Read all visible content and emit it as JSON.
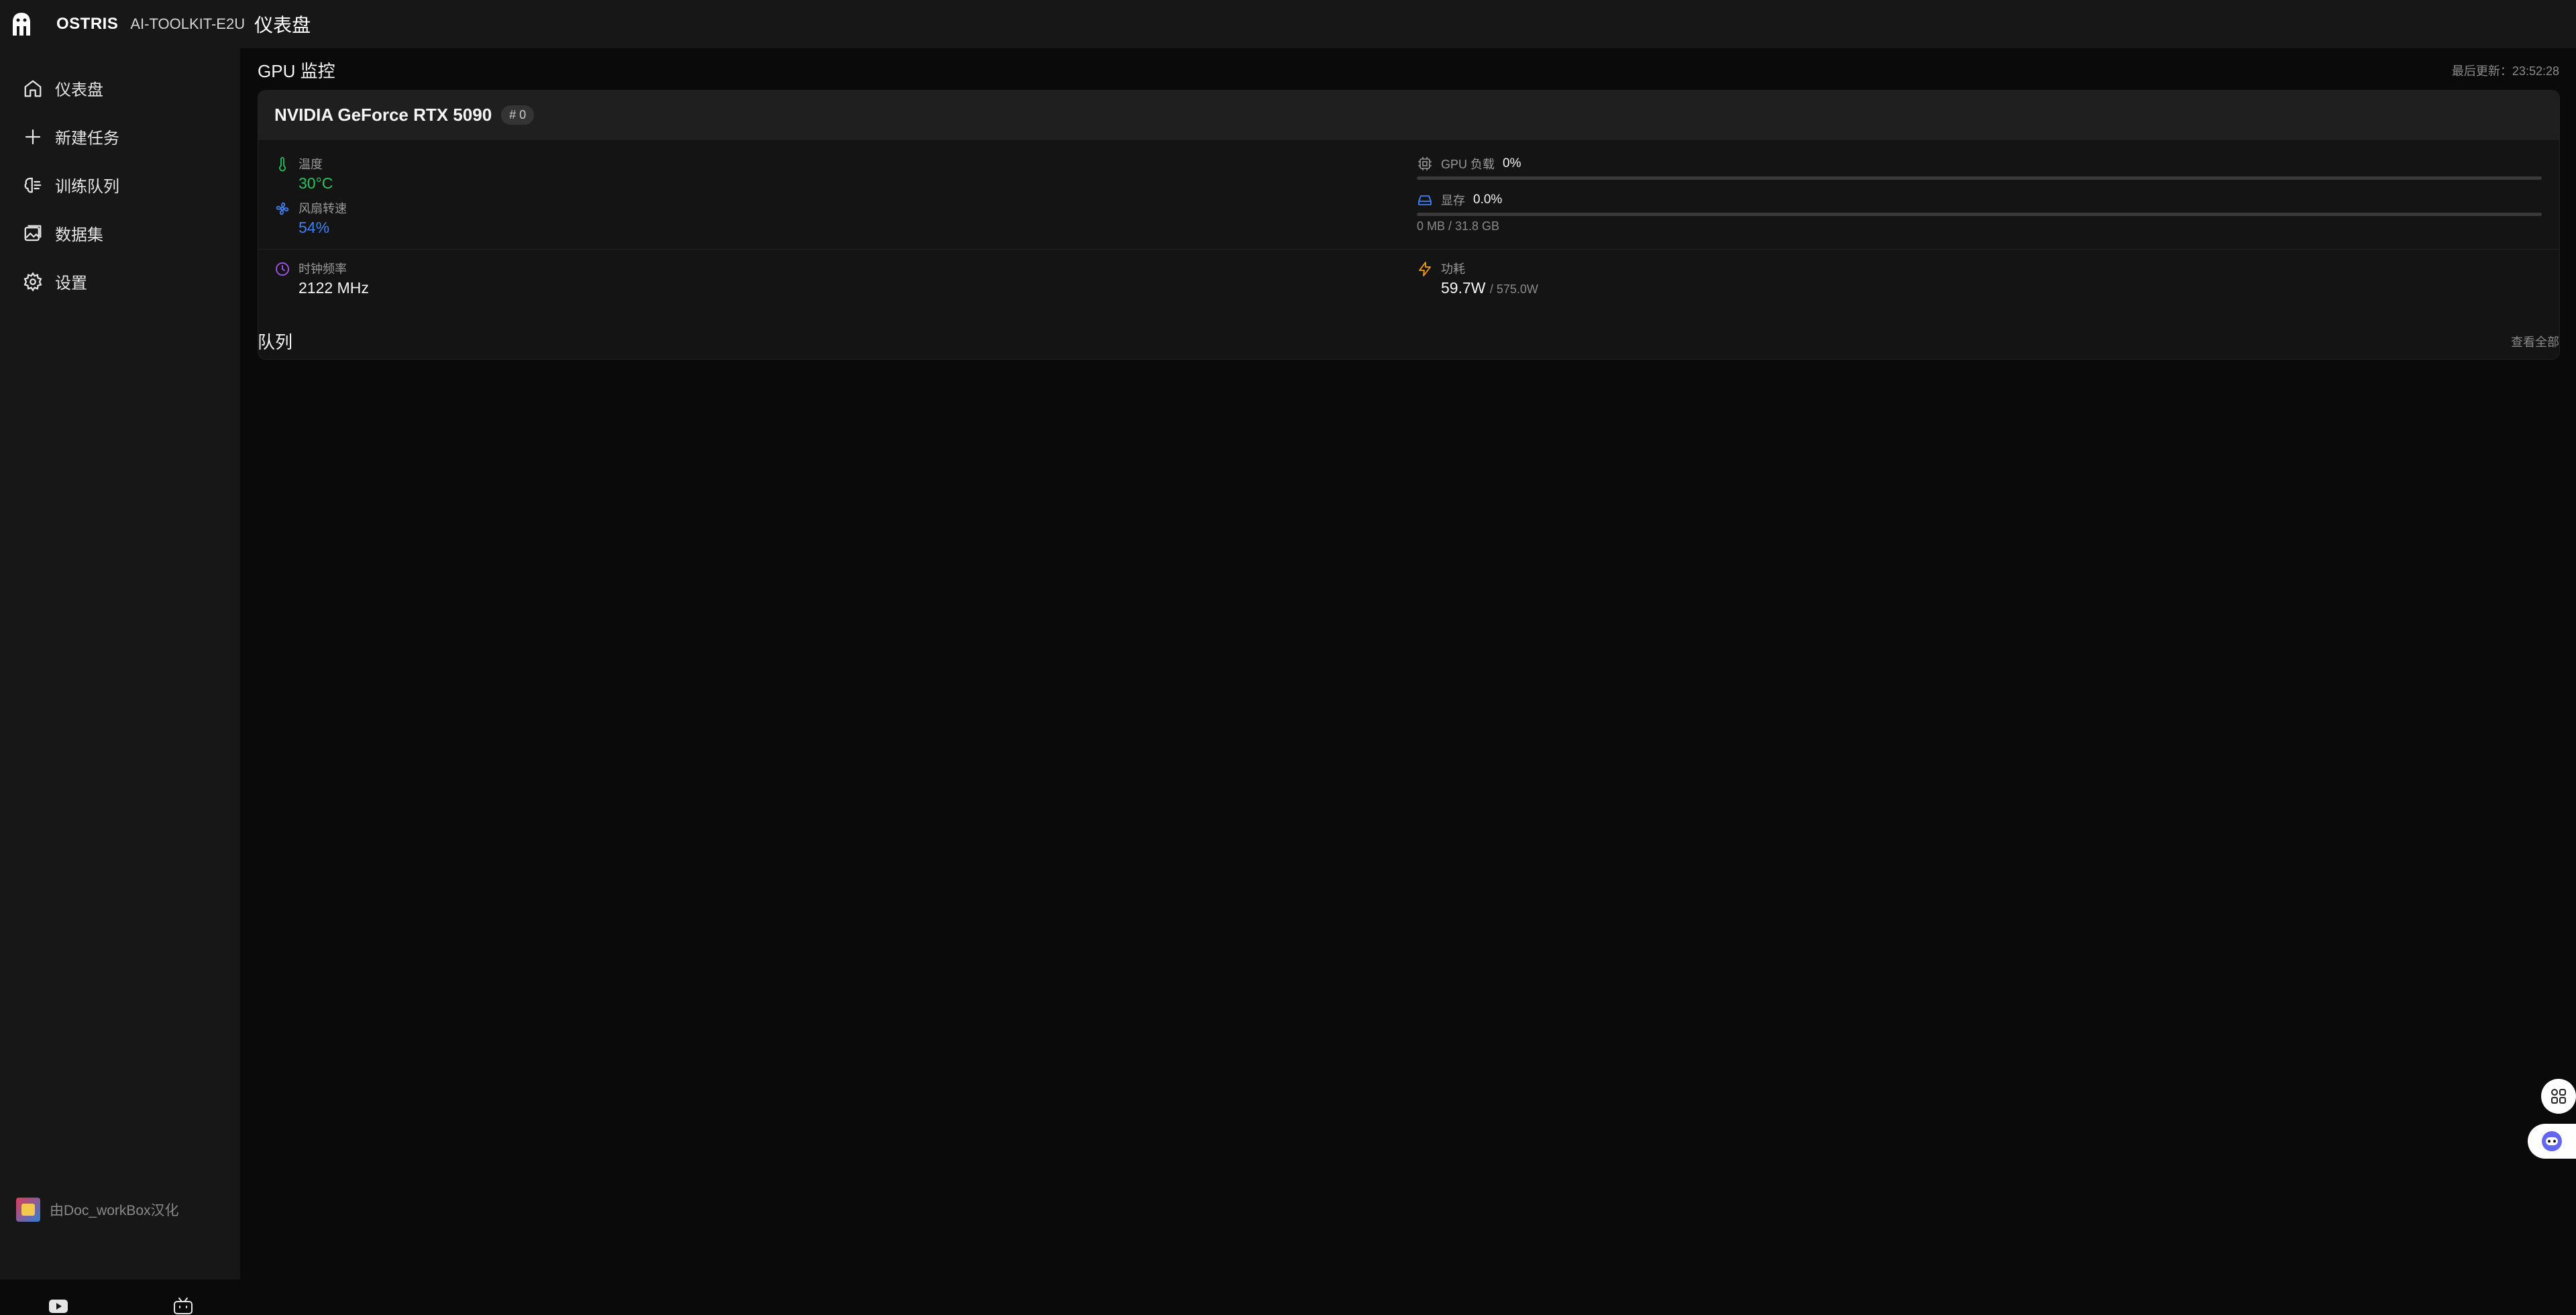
{
  "header": {
    "brand": "OSTRIS",
    "product": "AI-TOOLKIT-E2U",
    "page_title": "仪表盘"
  },
  "sidebar": {
    "items": [
      {
        "label": "仪表盘",
        "icon": "home-icon"
      },
      {
        "label": "新建任务",
        "icon": "plus-icon"
      },
      {
        "label": "训练队列",
        "icon": "brain-icon"
      },
      {
        "label": "数据集",
        "icon": "images-icon"
      },
      {
        "label": "设置",
        "icon": "gear-icon"
      }
    ],
    "credit": "由Doc_workBox汉化",
    "footer_icons": [
      "youtube-icon",
      "bilibili-icon"
    ]
  },
  "gpu_monitor": {
    "title": "GPU 监控",
    "last_update": "最后更新：23:52:28",
    "gpu": {
      "name": "NVIDIA GeForce RTX 5090",
      "index": "# 0",
      "temperature": {
        "label": "温度",
        "value": "30°C"
      },
      "fan": {
        "label": "风扇转速",
        "value": "54%"
      },
      "clock": {
        "label": "时钟频率",
        "value": "2122 MHz"
      },
      "load": {
        "label": "GPU 负载",
        "value": "0%",
        "fraction": 0
      },
      "memory": {
        "label": "显存",
        "value": "0.0%",
        "fraction": 0,
        "detail": "0 MB / 31.8 GB"
      },
      "power": {
        "label": "功耗",
        "value": "59.7W",
        "limit": "/ 575.0W"
      }
    }
  },
  "queue": {
    "title": "队列",
    "view_all": "查看全部"
  },
  "colors": {
    "temperature": "#22c55e",
    "fan": "#3b82f6",
    "clock_icon": "#a855f7",
    "power_icon": "#f59e0b"
  }
}
